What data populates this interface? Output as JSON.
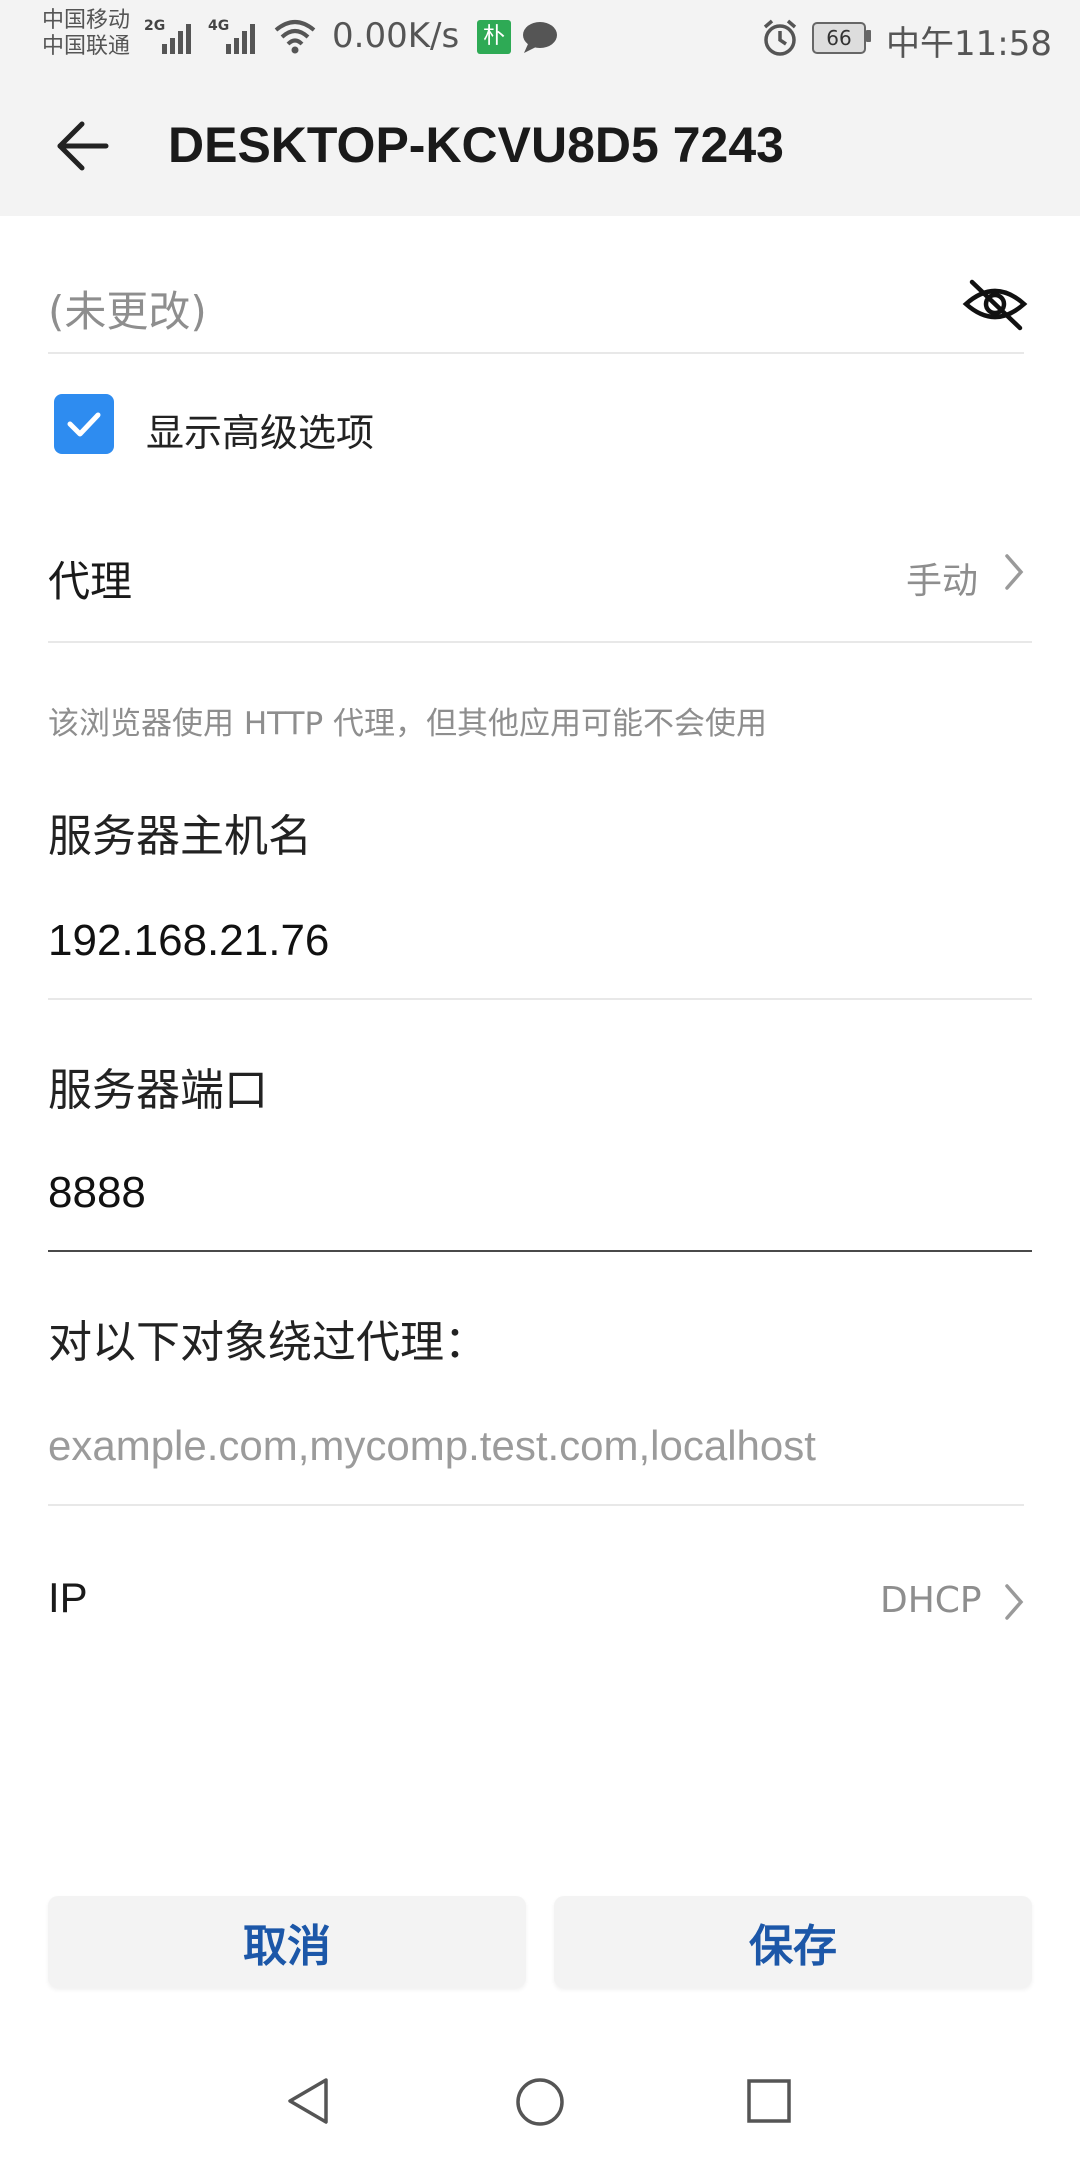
{
  "status_bar": {
    "carrier_1": "中国移动",
    "carrier_2": "中国联通",
    "net_1": "2G",
    "net_2": "4G",
    "net_speed": "0.00K/s",
    "app_badge": "朴",
    "battery": "66",
    "time": "中午11:58"
  },
  "app_bar": {
    "title": "DESKTOP-KCVU8D5 7243"
  },
  "form": {
    "password_value": "(未更改)",
    "show_advanced_label": "显示高级选项",
    "show_advanced_checked": true,
    "proxy": {
      "label": "代理",
      "value": "手动"
    },
    "proxy_hint": "该浏览器使用 HTTP 代理，但其他应用可能不会使用",
    "host": {
      "label": "服务器主机名",
      "value": "192.168.21.76"
    },
    "port": {
      "label": "服务器端口",
      "value": "8888"
    },
    "bypass": {
      "label": "对以下对象绕过代理：",
      "placeholder": "example.com,mycomp.test.com,localhost"
    },
    "ip": {
      "label": "IP",
      "value": "DHCP"
    }
  },
  "actions": {
    "cancel": "取消",
    "save": "保存"
  },
  "colors": {
    "accent": "#2e8cf0",
    "button_text": "#1c57a8"
  }
}
